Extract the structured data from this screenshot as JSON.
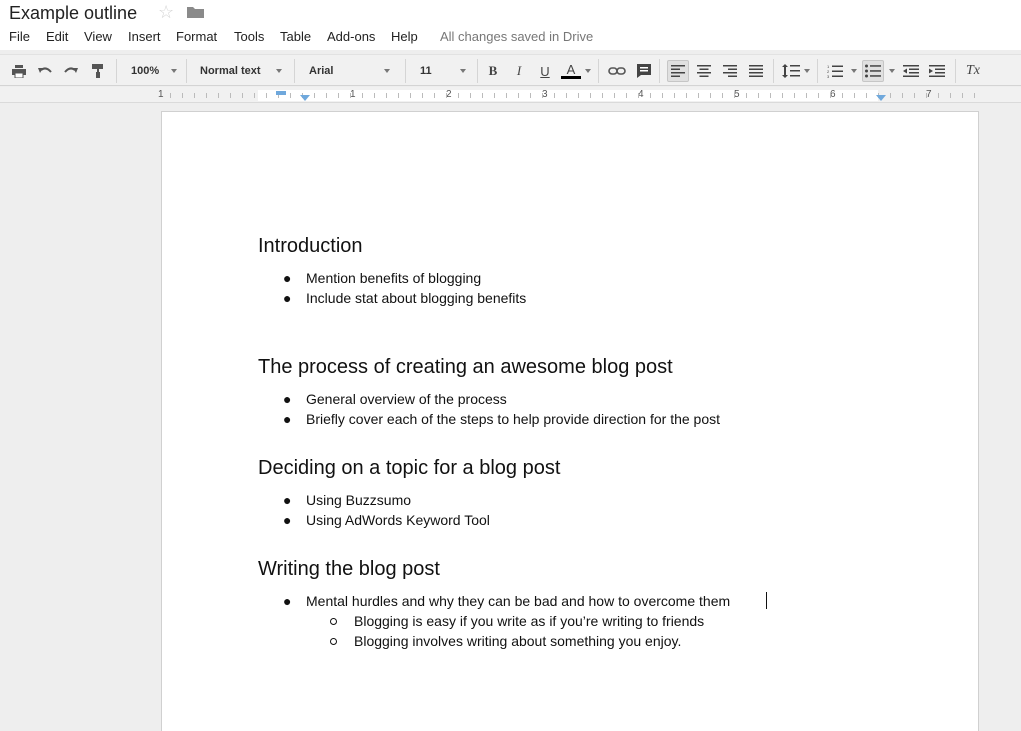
{
  "window": {
    "title": "Example outline",
    "save_status": "All changes saved in Drive"
  },
  "menu": [
    "File",
    "Edit",
    "View",
    "Insert",
    "Format",
    "Tools",
    "Table",
    "Add-ons",
    "Help"
  ],
  "toolbar": {
    "zoom": "100%",
    "style": "Normal text",
    "font": "Arial",
    "size": "11",
    "bold": "B",
    "italic": "I",
    "underline": "U",
    "text_color": "A",
    "clear_format": "Tx",
    "icons": [
      "print-icon",
      "undo-icon",
      "redo-icon",
      "paint-format-icon",
      "link-icon",
      "comment-icon",
      "align-left-icon",
      "align-center-icon",
      "align-right-icon",
      "justify-icon",
      "line-spacing-icon",
      "numbered-list-icon",
      "bulleted-list-icon",
      "decrease-indent-icon",
      "increase-indent-icon"
    ]
  },
  "ruler": {
    "numbers": [
      "1",
      "1",
      "2",
      "3",
      "4",
      "5",
      "6",
      "7"
    ]
  },
  "document": {
    "sections": [
      {
        "heading": "Introduction",
        "items": [
          "Mention benefits of blogging",
          "Include stat about blogging benefits"
        ]
      },
      {
        "heading": "The process of creating an awesome blog post",
        "items": [
          "General overview of the process",
          "Briefly cover each of the steps to help provide direction for the post"
        ]
      },
      {
        "heading": "Deciding on a topic for a blog post",
        "items": [
          "Using Buzzsumo",
          "Using AdWords Keyword Tool"
        ]
      },
      {
        "heading": "Writing the blog post",
        "items": [
          "Mental hurdles and why they can be bad and how to overcome them"
        ],
        "subitems": [
          "Blogging is easy if you write as if you’re writing to friends",
          "Blogging involves writing about something you enjoy."
        ]
      }
    ]
  },
  "colors": {
    "accent": "#6fa8dc",
    "text_color_bar": "#000000"
  }
}
